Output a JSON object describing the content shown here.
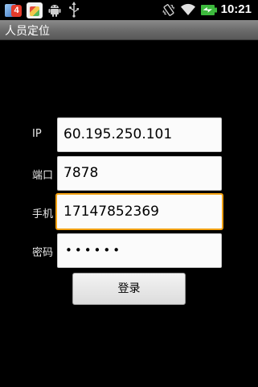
{
  "status_bar": {
    "notification_badge_count": "4",
    "time": "10:21",
    "icons": [
      "app-notification-icon",
      "market-icon",
      "android-debug-icon",
      "usb-icon",
      "vibrate-icon",
      "wifi-icon",
      "battery-charging-icon"
    ]
  },
  "title_bar": {
    "title": "人员定位"
  },
  "form": {
    "ip": {
      "label": "IP",
      "value": "60.195.250.101"
    },
    "port": {
      "label": "端口",
      "value": "7878"
    },
    "phone": {
      "label": "手机",
      "value": "17147852369"
    },
    "password": {
      "label": "密码",
      "value": "••••••"
    }
  },
  "login_button": {
    "label": "登录"
  },
  "colors": {
    "background": "#000000",
    "focus_border": "#f2a112",
    "battery": "#3dba3d"
  }
}
